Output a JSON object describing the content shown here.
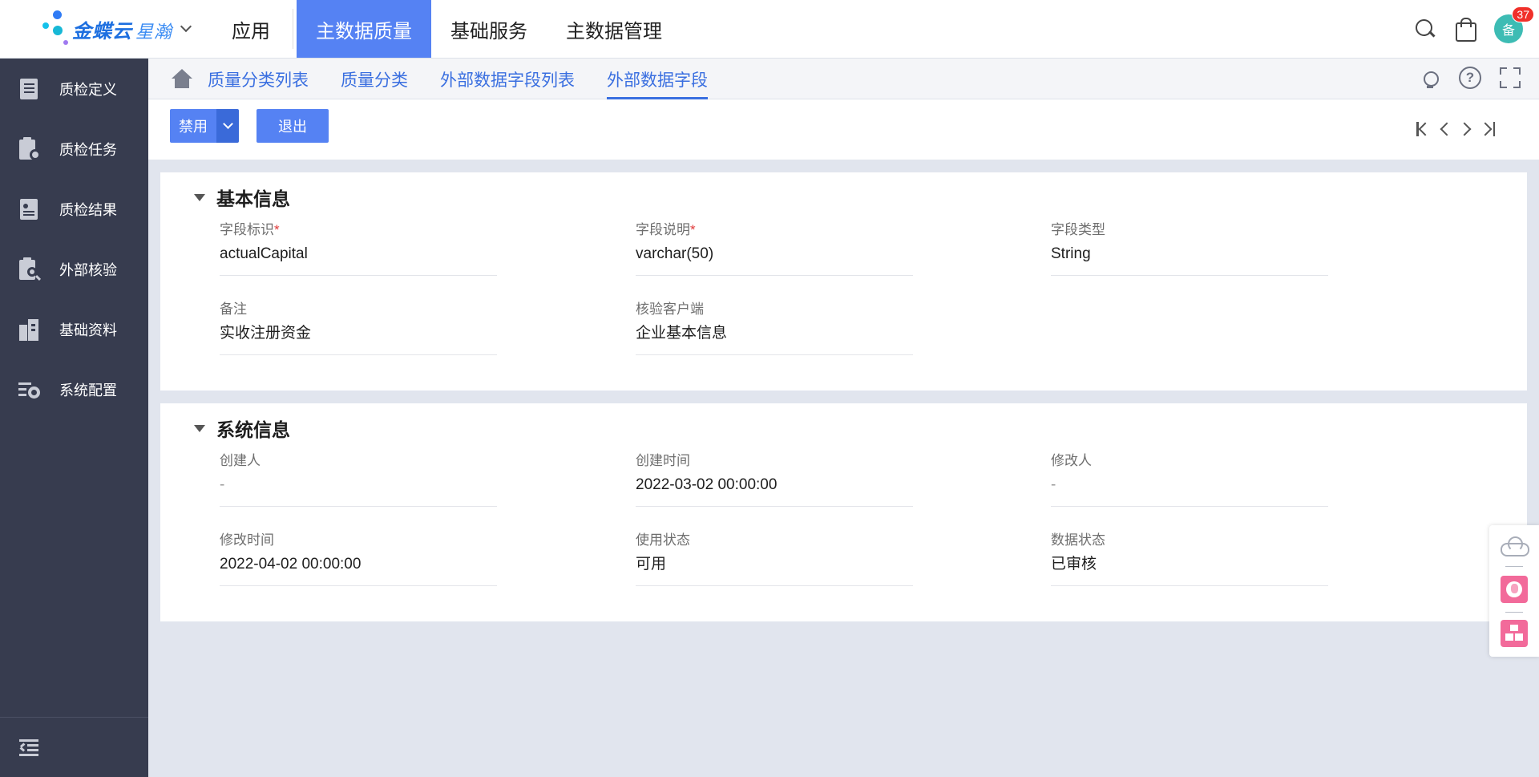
{
  "header": {
    "logo_text": "金蝶云",
    "logo_sub": "星瀚",
    "nav": [
      {
        "label": "应用",
        "active": false
      },
      {
        "label": "主数据质量",
        "active": true
      },
      {
        "label": "基础服务",
        "active": false
      },
      {
        "label": "主数据管理",
        "active": false
      }
    ],
    "icons": [
      "search-icon",
      "shopping-bag-icon"
    ],
    "avatar_text": "备",
    "notification_count": "37",
    "accent_color": "#5582f3"
  },
  "sidebar": {
    "items": [
      {
        "label": "质检定义",
        "icon": "book-icon"
      },
      {
        "label": "质检任务",
        "icon": "clipboard-gear-icon"
      },
      {
        "label": "质检结果",
        "icon": "report-icon"
      },
      {
        "label": "外部核验",
        "icon": "clipboard-search-icon"
      },
      {
        "label": "基础资料",
        "icon": "building-icon"
      },
      {
        "label": "系统配置",
        "icon": "settings-list-icon"
      }
    ],
    "collapse_icon": "collapse-menu-icon"
  },
  "breadcrumb": {
    "home_icon": "home-icon",
    "items": [
      {
        "label": "质量分类列表",
        "active": false
      },
      {
        "label": "质量分类",
        "active": false
      },
      {
        "label": "外部数据字段列表",
        "active": false
      },
      {
        "label": "外部数据字段",
        "active": true
      }
    ],
    "right_icons": [
      "lightbulb-icon",
      "help-icon",
      "fullscreen-icon"
    ]
  },
  "toolbar": {
    "disable_label": "禁用",
    "exit_label": "退出",
    "pager_icons": [
      "first-page-icon",
      "prev-page-icon",
      "next-page-icon",
      "last-page-icon"
    ]
  },
  "basic_info": {
    "title": "基本信息",
    "fields": [
      {
        "label": "字段标识",
        "required": true,
        "value": "actualCapital"
      },
      {
        "label": "字段说明",
        "required": true,
        "value": "varchar(50)"
      },
      {
        "label": "字段类型",
        "required": false,
        "value": "String"
      },
      {
        "label": "备注",
        "required": false,
        "value": "实收注册资金"
      },
      {
        "label": "核验客户端",
        "required": false,
        "value": "企业基本信息"
      }
    ]
  },
  "system_info": {
    "title": "系统信息",
    "fields": [
      {
        "label": "创建人",
        "value": "-"
      },
      {
        "label": "创建时间",
        "value": "2022-03-02 00:00:00"
      },
      {
        "label": "修改人",
        "value": "-"
      },
      {
        "label": "修改时间",
        "value": "2022-04-02 00:00:00"
      },
      {
        "label": "使用状态",
        "value": "可用"
      },
      {
        "label": "数据状态",
        "value": "已审核"
      }
    ]
  },
  "required_mark": "*",
  "float_panel": {
    "icons": [
      "cloud-icon",
      "globe-app-icon",
      "org-chart-app-icon"
    ]
  }
}
